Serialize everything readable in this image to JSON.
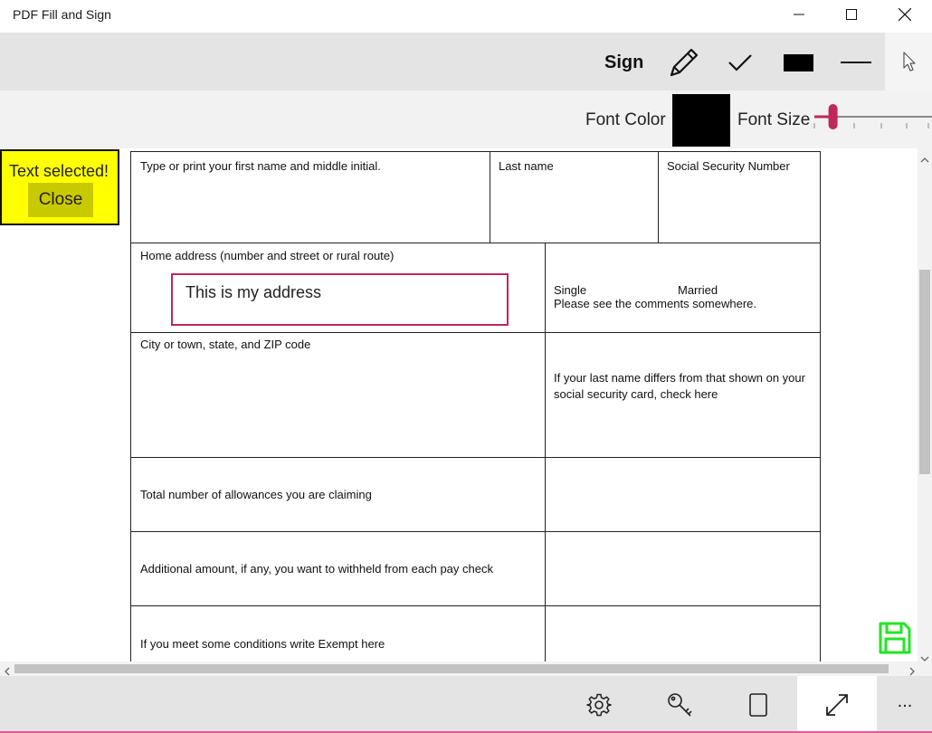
{
  "window": {
    "title": "PDF Fill and Sign"
  },
  "toolbar": {
    "sign_label": "Sign",
    "tools": [
      "pencil-icon",
      "checkmark-icon",
      "filled-rectangle-icon",
      "line-icon",
      "pointer-icon"
    ]
  },
  "fontbar": {
    "font_color_label": "Font Color",
    "font_color": "#000000",
    "font_size_label": "Font Size",
    "font_size_level": 0.1
  },
  "popup": {
    "message": "Text selected!",
    "close_label": "Close"
  },
  "form": {
    "row1": {
      "first_name_label": "Type or print your first name and middle initial.",
      "last_name_label": "Last name",
      "ssn_label": "Social Security Number"
    },
    "row2": {
      "home_address_label": "Home address (number and street or rural route)",
      "address_value": "This is my address",
      "single_label": "Single",
      "married_label": "Married",
      "comments_note": "Please see the comments somewhere."
    },
    "row3": {
      "city_label": "City or town, state, and ZIP code",
      "last_name_note_line1": "If your last name differs from that shown on your",
      "last_name_note_line2": "social security card, check here"
    },
    "row4": {
      "allowances_label": "Total number of allowances you are claiming"
    },
    "row5": {
      "additional_label": "Additional amount, if any, you want to withheld from each pay check"
    },
    "row6": {
      "exempt_label": "If you meet some conditions write Exempt here"
    }
  },
  "bottombar": {
    "icons": [
      "settings-icon",
      "key-icon",
      "page-icon",
      "fullscreen-icon",
      "more-icon"
    ],
    "more_label": "..."
  },
  "colors": {
    "accent": "#c0285a",
    "popup_bg": "#ffff00",
    "save_icon": "#22e622"
  }
}
